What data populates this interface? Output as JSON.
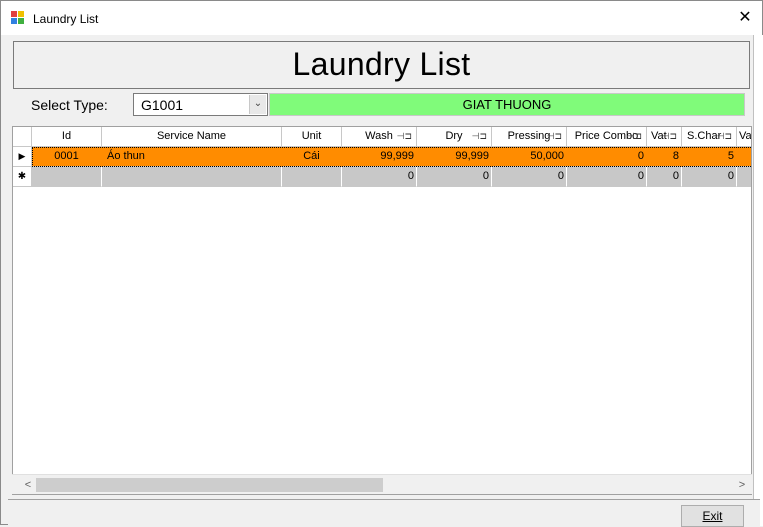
{
  "window": {
    "title": "Laundry List",
    "close_glyph": "✕"
  },
  "header": {
    "title": "Laundry List"
  },
  "select": {
    "label": "Select Type:",
    "value": "G1001",
    "type_name": "GIAT THUONG"
  },
  "grid": {
    "columns": [
      "Id",
      "Service Name",
      "Unit",
      "Wash",
      "Dry",
      "Pressing",
      "Price Combo",
      "Vat",
      "S.Char",
      "Va"
    ],
    "rows": [
      {
        "marker": "▶",
        "cells": [
          "0001",
          "Áo thun",
          "Cái",
          "99,999",
          "99,999",
          "50,000",
          "0",
          "8",
          "5",
          ""
        ]
      },
      {
        "marker": "✱",
        "cells": [
          "",
          "",
          "",
          "0",
          "0",
          "0",
          "0",
          "0",
          "0",
          ""
        ]
      }
    ]
  },
  "scroll": {
    "left_arrow": "<",
    "right_arrow": ">"
  },
  "footer": {
    "exit_label": "Exit"
  },
  "colors": {
    "selected_row": "#ff8c00",
    "type_display": "#80fb7a",
    "new_row": "#c8c8c8"
  }
}
